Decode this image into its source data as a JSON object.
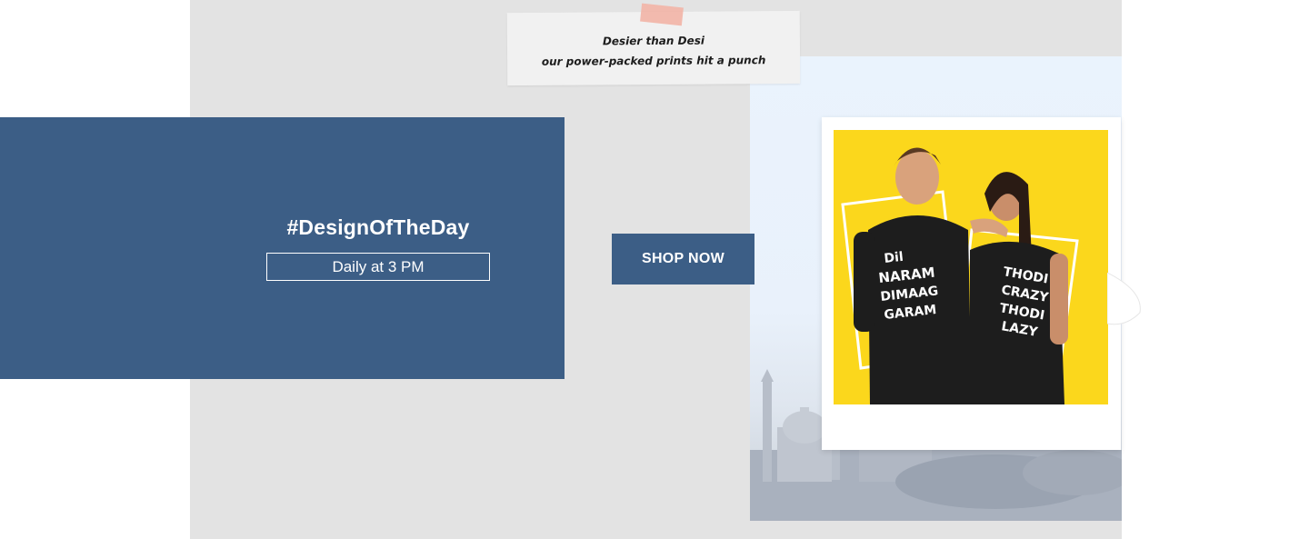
{
  "note": {
    "line1": "Desier than Desi",
    "line2": "our power-packed prints hit a punch"
  },
  "promo": {
    "title": "#DesignOfTheDay",
    "schedule": "Daily at 3 PM"
  },
  "cta": {
    "label": "SHOP NOW"
  },
  "product_photo": {
    "tee_left_text": "Dil Naram Dimaag Garam",
    "tee_right_text": "Thodi Crazy Thodi Lazy"
  },
  "colors": {
    "brand_blue": "#3c5e86",
    "photo_yellow": "#fbd71c",
    "background_grey": "#e3e3e3"
  }
}
